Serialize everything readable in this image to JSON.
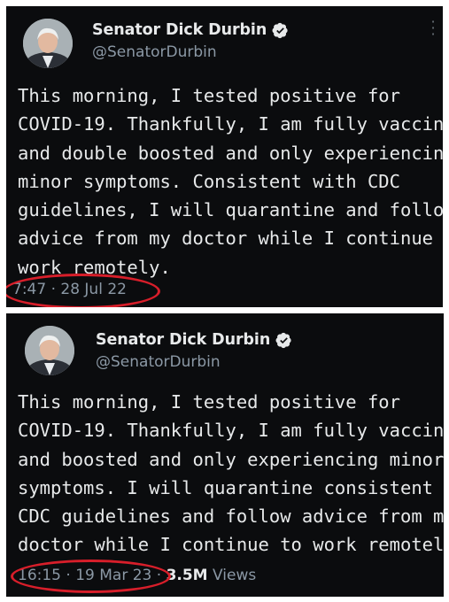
{
  "tweets": [
    {
      "display_name": "Senator Dick Durbin",
      "handle": "@SenatorDurbin",
      "text": "This morning, I tested positive for\nCOVID-19. Thankfully, I am fully vaccinated\nand double boosted and only experiencing\nminor symptoms. Consistent with CDC\nguidelines, I will quarantine and follow\nadvice from my doctor while I continue to\nwork remotely.",
      "timestamp": "7:47 · 28 Jul 22",
      "verified": true,
      "more_icon": "more-vertical-icon"
    },
    {
      "display_name": "Senator Dick Durbin",
      "handle": "@SenatorDurbin",
      "text": "This morning, I tested positive for\nCOVID-19. Thankfully, I am fully vaccinated\nand boosted and only experiencing minor\nsymptoms. I will quarantine consistent with\nCDC guidelines and follow advice from my\ndoctor while I continue to work remotely.",
      "timestamp": "16:15 · 19 Mar 23 ·",
      "views_count": "3.5M",
      "views_label": "Views",
      "verified": true
    }
  ],
  "colors": {
    "panel_bg": "#0b0c0e",
    "text": "#e7e9ea",
    "secondary": "#8b98a5",
    "highlight_circle": "#d81e2a",
    "badge": "#e7e9ea"
  }
}
